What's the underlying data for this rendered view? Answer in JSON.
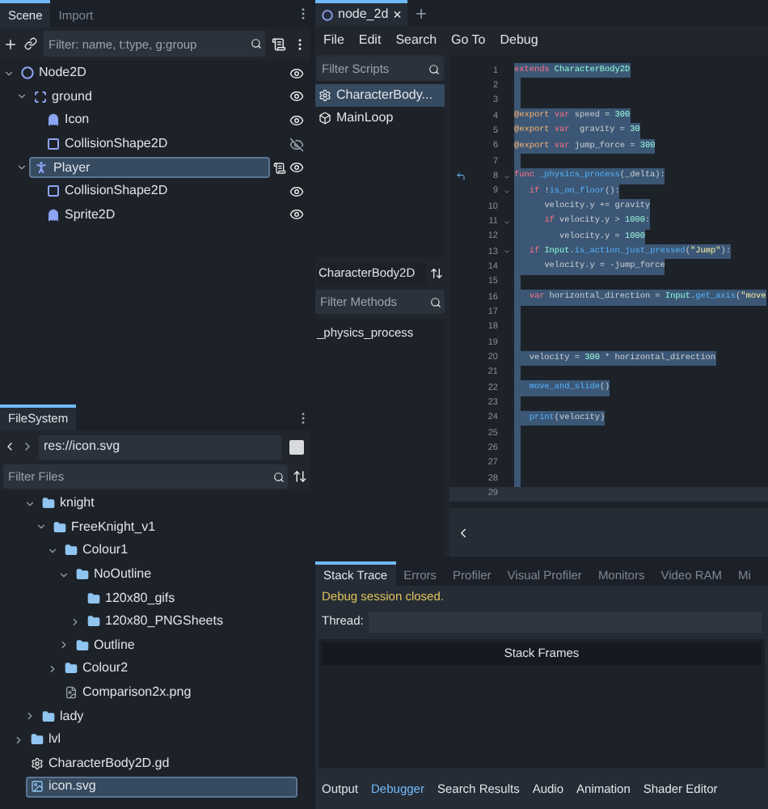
{
  "scene_dock": {
    "tabs": [
      {
        "label": "Scene",
        "selected": true
      },
      {
        "label": "Import",
        "selected": false
      }
    ],
    "filter": {
      "placeholder": "Filter: name, t:type, g:group"
    },
    "tree": [
      {
        "name": "Node2D",
        "kind": "node2d",
        "visible": true,
        "selected": false,
        "script": false,
        "expanded": true,
        "children": [
          {
            "name": "ground",
            "kind": "static",
            "visible": true,
            "selected": false,
            "script": false,
            "expanded": true,
            "children": [
              {
                "name": "Icon",
                "kind": "sprite",
                "visible": true,
                "selected": false,
                "script": false
              },
              {
                "name": "CollisionShape2D",
                "kind": "collision",
                "visible": false,
                "selected": false,
                "script": false
              }
            ]
          },
          {
            "name": "Player",
            "kind": "character",
            "visible": true,
            "selected": true,
            "script": true,
            "expanded": true,
            "children": [
              {
                "name": "CollisionShape2D",
                "kind": "collision",
                "visible": true,
                "selected": false,
                "script": false
              },
              {
                "name": "Sprite2D",
                "kind": "sprite",
                "visible": true,
                "selected": false,
                "script": false
              }
            ]
          }
        ]
      }
    ]
  },
  "filesystem": {
    "tabs": [
      {
        "label": "FileSystem",
        "selected": true
      }
    ],
    "path": "res://icon.svg",
    "filter": {
      "placeholder": "Filter Files"
    },
    "tree": [
      {
        "children": [
          {
            "name": "knight",
            "kind": "folder",
            "expanded": true,
            "selected": false,
            "children": [
              {
                "name": "FreeKnight_v1",
                "kind": "folder",
                "expanded": true,
                "selected": false,
                "children": [
                  {
                    "name": "Colour1",
                    "kind": "folder",
                    "expanded": true,
                    "selected": false,
                    "children": [
                      {
                        "name": "NoOutline",
                        "kind": "folder",
                        "expanded": true,
                        "selected": false,
                        "children": [
                          {
                            "name": "120x80_gifs",
                            "kind": "folder",
                            "selected": false
                          },
                          {
                            "name": "120x80_PNGSheets",
                            "kind": "folder",
                            "expanded": false,
                            "selected": false
                          }
                        ]
                      },
                      {
                        "name": "Outline",
                        "kind": "folder",
                        "expanded": false,
                        "selected": false
                      }
                    ]
                  },
                  {
                    "name": "Colour2",
                    "kind": "folder",
                    "expanded": false,
                    "selected": false
                  },
                  {
                    "name": "Comparison2x.png",
                    "kind": "image",
                    "selected": false
                  }
                ]
              }
            ]
          },
          {
            "name": "lady",
            "kind": "folder",
            "expanded": false,
            "selected": false
          }
        ]
      },
      {
        "name": "lvl",
        "kind": "folder",
        "expanded": false,
        "selected": false
      },
      {
        "name": "CharacterBody2D.gd",
        "kind": "script",
        "selected": false
      },
      {
        "name": "icon.svg",
        "kind": "svg",
        "selected": true
      }
    ]
  },
  "editor_tabs": [
    {
      "label": "node_2d",
      "selected": true,
      "close": "×"
    }
  ],
  "menu": [
    "File",
    "Edit",
    "Search",
    "Go To",
    "Debug"
  ],
  "scripts": {
    "filter": {
      "placeholder": "Filter Scripts"
    },
    "items": [
      {
        "name": "CharacterBody...",
        "kind": "script",
        "selected": true
      },
      {
        "name": "MainLoop",
        "kind": "object",
        "selected": false
      }
    ],
    "class_name": "CharacterBody2D",
    "methods_filter": {
      "placeholder": "Filter Methods"
    },
    "methods": [
      "_physics_process"
    ]
  },
  "code": {
    "lines": [
      {
        "n": "1",
        "selected": true,
        "current": false,
        "fold": false,
        "override": false,
        "tokens": [
          {
            "kind": "kw",
            "text": "extends"
          },
          {
            "kind": "type",
            "text": " CharacterBody2D"
          }
        ]
      },
      {
        "n": "2",
        "selected": true,
        "current": false,
        "fold": false,
        "override": false
      },
      {
        "n": "3",
        "selected": true,
        "current": false,
        "fold": false,
        "override": false
      },
      {
        "n": "4",
        "selected": true,
        "current": false,
        "fold": false,
        "override": false,
        "tokens": [
          {
            "kind": "ann",
            "text": "@export"
          },
          {
            "kind": "kw",
            "text": " var"
          },
          {
            "kind": "plain",
            "text": " speed = "
          },
          {
            "kind": "num",
            "text": "300"
          }
        ]
      },
      {
        "n": "5",
        "selected": true,
        "current": false,
        "fold": false,
        "override": false,
        "tokens": [
          {
            "kind": "ann",
            "text": "@export"
          },
          {
            "kind": "kw",
            "text": " var"
          },
          {
            "kind": "plain",
            "text": "  gravity = "
          },
          {
            "kind": "num",
            "text": "30"
          }
        ]
      },
      {
        "n": "6",
        "selected": true,
        "current": false,
        "fold": false,
        "override": false,
        "tokens": [
          {
            "kind": "ann",
            "text": "@export"
          },
          {
            "kind": "kw",
            "text": " var"
          },
          {
            "kind": "plain",
            "text": " jump_force = "
          },
          {
            "kind": "num",
            "text": "300"
          }
        ]
      },
      {
        "n": "7",
        "selected": true,
        "current": false,
        "fold": false,
        "override": false
      },
      {
        "n": "8",
        "selected": true,
        "current": false,
        "fold": true,
        "override": true,
        "tokens": [
          {
            "kind": "kw",
            "text": "func"
          },
          {
            "kind": "fn",
            "text": " _physics_process"
          },
          {
            "kind": "plain",
            "text": "(_delta):"
          }
        ]
      },
      {
        "n": "9",
        "selected": true,
        "current": false,
        "fold": true,
        "override": false,
        "tokens": [
          {
            "kind": "kw",
            "text": "\tif"
          },
          {
            "kind": "plain",
            "text": " !"
          },
          {
            "kind": "fn",
            "text": "is_on_floor"
          },
          {
            "kind": "plain",
            "text": "():"
          }
        ]
      },
      {
        "n": "10",
        "selected": true,
        "current": false,
        "fold": false,
        "override": false,
        "tokens": [
          {
            "kind": "plain",
            "text": "\t\tvelocity.y += gravity"
          }
        ]
      },
      {
        "n": "11",
        "selected": true,
        "current": false,
        "fold": true,
        "override": false,
        "tokens": [
          {
            "kind": "kw",
            "text": "\t\tif"
          },
          {
            "kind": "plain",
            "text": " velocity.y > "
          },
          {
            "kind": "num",
            "text": "1000"
          },
          {
            "kind": "plain",
            "text": ":"
          }
        ]
      },
      {
        "n": "12",
        "selected": true,
        "current": false,
        "fold": false,
        "override": false,
        "tokens": [
          {
            "kind": "plain",
            "text": "\t\t\tvelocity.y = "
          },
          {
            "kind": "num",
            "text": "1000"
          }
        ]
      },
      {
        "n": "13",
        "selected": true,
        "current": false,
        "fold": true,
        "override": false,
        "tokens": [
          {
            "kind": "kw",
            "text": "\tif"
          },
          {
            "kind": "type",
            "text": " Input"
          },
          {
            "kind": "plain",
            "text": "."
          },
          {
            "kind": "fn",
            "text": "is_action_just_pressed"
          },
          {
            "kind": "plain",
            "text": "("
          },
          {
            "kind": "str",
            "text": "\"Jump\""
          },
          {
            "kind": "plain",
            "text": "):"
          }
        ]
      },
      {
        "n": "14",
        "selected": true,
        "current": false,
        "fold": false,
        "override": false,
        "tokens": [
          {
            "kind": "plain",
            "text": "\t\tvelocity.y = -jump_force"
          }
        ]
      },
      {
        "n": "15",
        "selected": true,
        "current": false,
        "fold": false,
        "override": false
      },
      {
        "n": "16",
        "selected": true,
        "current": false,
        "fold": false,
        "override": false,
        "tokens": [
          {
            "kind": "kw",
            "text": "\tvar"
          },
          {
            "kind": "plain",
            "text": " horizontal_direction = "
          },
          {
            "kind": "type",
            "text": "Input"
          },
          {
            "kind": "plain",
            "text": "."
          },
          {
            "kind": "fn",
            "text": "get_axis"
          },
          {
            "kind": "plain",
            "text": "("
          },
          {
            "kind": "str",
            "text": "\"move"
          }
        ]
      },
      {
        "n": "17",
        "selected": true,
        "current": false,
        "fold": false,
        "override": false
      },
      {
        "n": "18",
        "selected": true,
        "current": false,
        "fold": false,
        "override": false
      },
      {
        "n": "19",
        "selected": true,
        "current": false,
        "fold": false,
        "override": false
      },
      {
        "n": "20",
        "selected": true,
        "current": false,
        "fold": false,
        "override": false,
        "tokens": [
          {
            "kind": "plain",
            "text": "\tvelocity = "
          },
          {
            "kind": "num",
            "text": "300"
          },
          {
            "kind": "plain",
            "text": " * horizontal_direction"
          }
        ]
      },
      {
        "n": "21",
        "selected": true,
        "current": false,
        "fold": false,
        "override": false
      },
      {
        "n": "22",
        "selected": true,
        "current": false,
        "fold": false,
        "override": false,
        "tokens": [
          {
            "kind": "fn",
            "text": "\tmove_and_slide"
          },
          {
            "kind": "plain",
            "text": "()"
          }
        ]
      },
      {
        "n": "23",
        "selected": true,
        "current": false,
        "fold": false,
        "override": false
      },
      {
        "n": "24",
        "selected": true,
        "current": false,
        "fold": false,
        "override": false,
        "tokens": [
          {
            "kind": "fn",
            "text": "\tprint"
          },
          {
            "kind": "plain",
            "text": "(velocity)"
          }
        ]
      },
      {
        "n": "25",
        "selected": true,
        "current": false,
        "fold": false,
        "override": false
      },
      {
        "n": "26",
        "selected": true,
        "current": false,
        "fold": false,
        "override": false
      },
      {
        "n": "27",
        "selected": true,
        "current": false,
        "fold": false,
        "override": false
      },
      {
        "n": "28",
        "selected": true,
        "current": false,
        "fold": false,
        "override": false
      },
      {
        "n": "29",
        "selected": false,
        "current": true,
        "fold": false,
        "override": false
      }
    ]
  },
  "bottom_panel": {
    "tabs": [
      {
        "label": "Stack Trace",
        "selected": true
      },
      {
        "label": "Errors",
        "selected": false
      },
      {
        "label": "Profiler",
        "selected": false
      },
      {
        "label": "Visual Profiler",
        "selected": false
      },
      {
        "label": "Monitors",
        "selected": false
      },
      {
        "label": "Video RAM",
        "selected": false
      },
      {
        "label": "Mi",
        "selected": false
      }
    ],
    "status": "Debug session closed.",
    "thread_label": "Thread:",
    "stack_header": "Stack Frames"
  },
  "bottom_bar": [
    {
      "label": "Output",
      "selected": false
    },
    {
      "label": "Debugger",
      "selected": true
    },
    {
      "label": "Search Results",
      "selected": false
    },
    {
      "label": "Audio",
      "selected": false
    },
    {
      "label": "Animation",
      "selected": false
    },
    {
      "label": "Shader Editor",
      "selected": false
    }
  ]
}
